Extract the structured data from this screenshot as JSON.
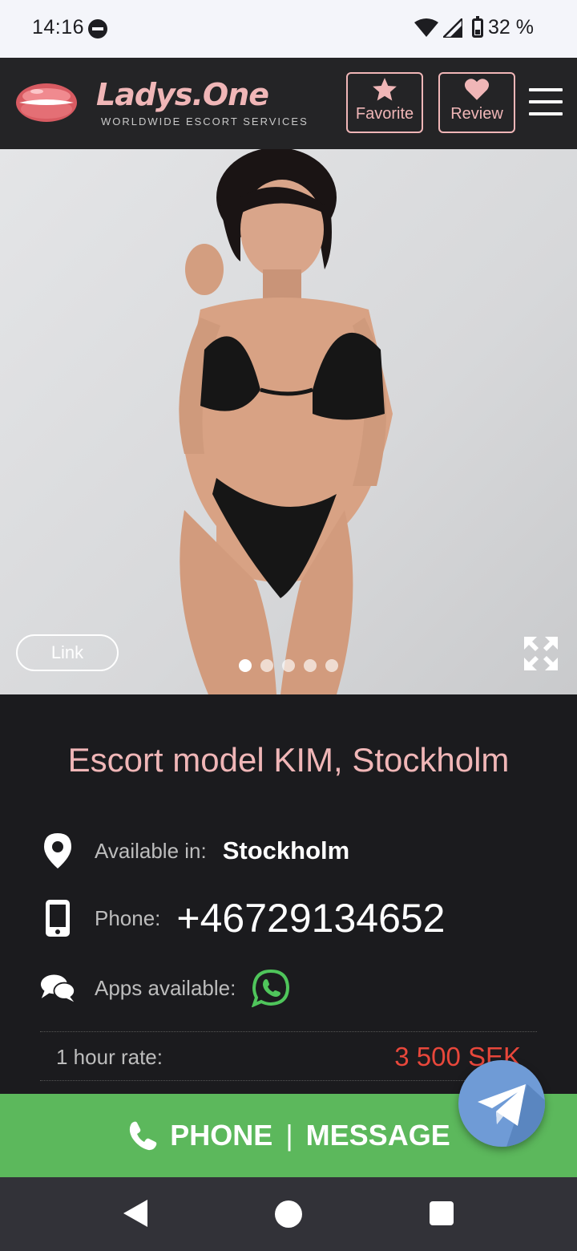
{
  "status_bar": {
    "time": "14:16",
    "battery": "32 %",
    "battery_level": 0.32
  },
  "header": {
    "brand": "Ladys.One",
    "tagline": "WORLDWIDE ESCORT SERVICES",
    "favorite_label": "Favorite",
    "review_label": "Review",
    "accent_color": "#f0b6b7"
  },
  "gallery": {
    "link_label": "Link",
    "total_photos": 5,
    "active_index": 1
  },
  "profile": {
    "title": "Escort model KIM, Stockholm",
    "available_label": "Available in:",
    "available_value": "Stockholm",
    "phone_label": "Phone:",
    "phone_value": "+46729134652",
    "apps_label": "Apps available:",
    "rate_label": "1 hour rate:",
    "rate_value": "3 500 SEK"
  },
  "call_bar": {
    "phone_label": "PHONE",
    "separator": "|",
    "message_label": "MESSAGE",
    "color": "#5cb85c"
  }
}
